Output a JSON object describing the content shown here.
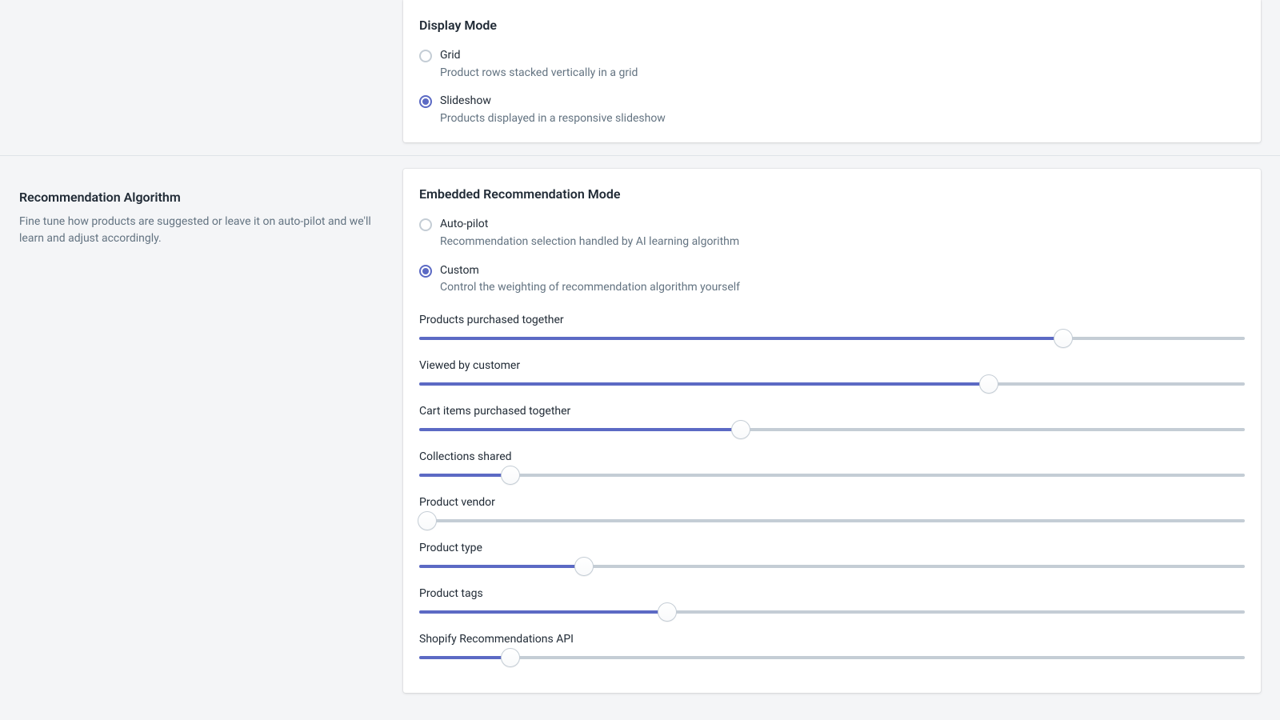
{
  "display_mode": {
    "title": "Display Mode",
    "options": [
      {
        "label": "Grid",
        "desc": "Product rows stacked vertically in a grid",
        "checked": false
      },
      {
        "label": "Slideshow",
        "desc": "Products displayed in a responsive slideshow",
        "checked": true
      }
    ]
  },
  "algorithm_section": {
    "title": "Recommendation Algorithm",
    "desc": "Fine tune how products are suggested or leave it on auto-pilot and we'll learn and adjust accordingly."
  },
  "recommendation_mode": {
    "title": "Embedded Recommendation Mode",
    "options": [
      {
        "label": "Auto-pilot",
        "desc": "Recommendation selection handled by AI learning algorithm",
        "checked": false
      },
      {
        "label": "Custom",
        "desc": "Control the weighting of recommendation algorithm yourself",
        "checked": true
      }
    ]
  },
  "sliders": [
    {
      "label": "Products purchased together",
      "value": 78
    },
    {
      "label": "Viewed by customer",
      "value": 69
    },
    {
      "label": "Cart items purchased together",
      "value": 39
    },
    {
      "label": "Collections shared",
      "value": 11
    },
    {
      "label": "Product vendor",
      "value": 1
    },
    {
      "label": "Product type",
      "value": 20
    },
    {
      "label": "Product tags",
      "value": 30
    },
    {
      "label": "Shopify Recommendations API",
      "value": 11
    }
  ]
}
